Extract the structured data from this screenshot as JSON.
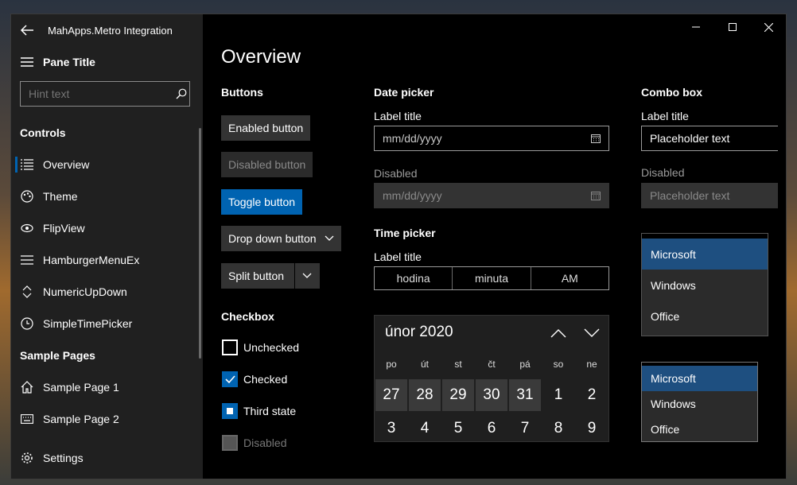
{
  "app": {
    "title": "MahApps.Metro Integration"
  },
  "pane": {
    "title": "Pane Title",
    "search_placeholder": "Hint text",
    "groups": [
      {
        "header": "Controls",
        "items": [
          {
            "label": "Overview",
            "icon": "list-icon",
            "selected": true
          },
          {
            "label": "Theme",
            "icon": "palette-icon"
          },
          {
            "label": "FlipView",
            "icon": "eye-icon"
          },
          {
            "label": "HamburgerMenuEx",
            "icon": "hamburger-icon"
          },
          {
            "label": "NumericUpDown",
            "icon": "up-down-icon"
          },
          {
            "label": "SimpleTimePicker",
            "icon": "clock-icon"
          }
        ]
      },
      {
        "header": "Sample Pages",
        "items": [
          {
            "label": "Sample Page 1",
            "icon": "home-icon"
          },
          {
            "label": "Sample Page 2",
            "icon": "keyboard-icon"
          }
        ]
      }
    ],
    "settings_label": "Settings"
  },
  "content": {
    "title": "Overview",
    "buttons": {
      "header": "Buttons",
      "enabled": "Enabled button",
      "disabled": "Disabled button",
      "toggle": "Toggle button",
      "dropdown": "Drop down button",
      "split": "Split button"
    },
    "checkbox": {
      "header": "Checkbox",
      "unchecked": "Unchecked",
      "checked": "Checked",
      "third": "Third state",
      "disabled_partial": "Disabled"
    },
    "date_picker": {
      "header": "Date picker",
      "label": "Label title",
      "placeholder": "mm/dd/yyyy",
      "disabled_label": "Disabled",
      "disabled_placeholder": "mm/dd/yyyy"
    },
    "time_picker": {
      "header": "Time picker",
      "label": "Label title",
      "hour": "hodina",
      "minute": "minuta",
      "period": "AM"
    },
    "calendar": {
      "month": "únor 2020",
      "days_of_week": [
        "po",
        "út",
        "st",
        "čt",
        "pá",
        "so",
        "ne"
      ],
      "week1": [
        "27",
        "28",
        "29",
        "30",
        "31",
        "1",
        "2"
      ],
      "week2": [
        "3",
        "4",
        "5",
        "6",
        "7",
        "8",
        "9"
      ]
    },
    "combo": {
      "header": "Combo box",
      "label": "Label title",
      "placeholder": "Placeholder text",
      "disabled_label": "Disabled",
      "disabled_placeholder": "Placeholder text",
      "list1": [
        "Microsoft",
        "Windows",
        "Office"
      ],
      "list2": [
        "Microsoft",
        "Windows",
        "Office"
      ]
    }
  },
  "colors": {
    "accent": "#0063b1",
    "selected_item": "#1e4f80"
  }
}
